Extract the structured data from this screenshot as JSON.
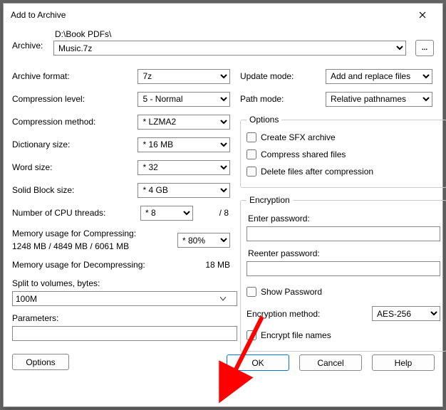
{
  "title": "Add to Archive",
  "archive": {
    "label": "Archive:",
    "path": "D:\\Book PDFs\\",
    "filename": "Music.7z",
    "browse": "..."
  },
  "left": {
    "format": {
      "label": "Archive format:",
      "value": "7z"
    },
    "level": {
      "label": "Compression level:",
      "value": "5 - Normal"
    },
    "method": {
      "label": "Compression method:",
      "value": "* LZMA2"
    },
    "dict": {
      "label": "Dictionary size:",
      "value": "* 16 MB"
    },
    "word": {
      "label": "Word size:",
      "value": "* 32"
    },
    "block": {
      "label": "Solid Block size:",
      "value": "* 4 GB"
    },
    "threads": {
      "label": "Number of CPU threads:",
      "value": "* 8",
      "total": "/ 8"
    },
    "memc_label": "Memory usage for Compressing:",
    "memc_value": "1248 MB / 4849 MB / 6061 MB",
    "memc_percent": "* 80%",
    "memd_label": "Memory usage for Decompressing:",
    "memd_value": "18 MB",
    "split_label": "Split to volumes, bytes:",
    "split_value": "100M",
    "params_label": "Parameters:",
    "params_value": "",
    "options_btn": "Options"
  },
  "right": {
    "update": {
      "label": "Update mode:",
      "value": "Add and replace files"
    },
    "pathmode": {
      "label": "Path mode:",
      "value": "Relative pathnames"
    },
    "options_legend": "Options",
    "opt_sfx": "Create SFX archive",
    "opt_shared": "Compress shared files",
    "opt_delete": "Delete files after compression",
    "enc_legend": "Encryption",
    "enter_pw": "Enter password:",
    "reenter_pw": "Reenter password:",
    "show_pw": "Show Password",
    "enc_method_label": "Encryption method:",
    "enc_method_value": "AES-256",
    "enc_names": "Encrypt file names"
  },
  "footer": {
    "ok": "OK",
    "cancel": "Cancel",
    "help": "Help"
  }
}
